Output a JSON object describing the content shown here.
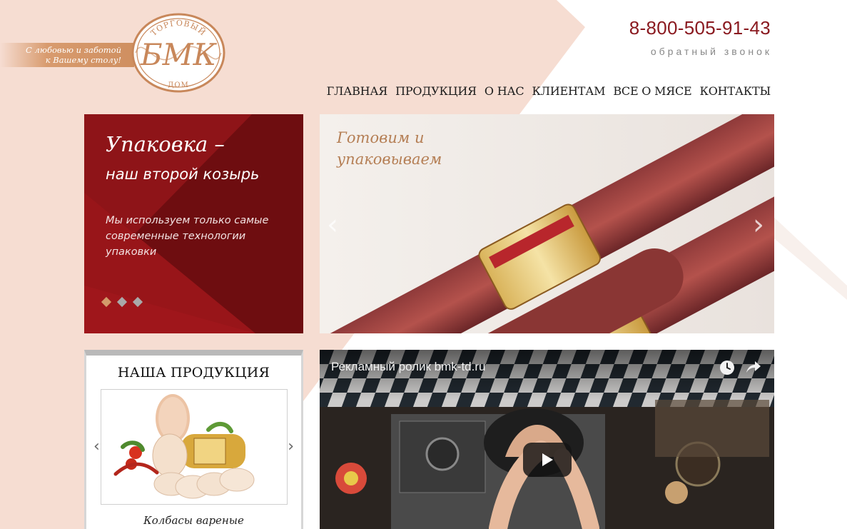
{
  "header": {
    "tagline_line1": "С любовью и заботой",
    "tagline_line2": "к Вашему столу!",
    "logo": {
      "top_text": "ТОРГОВЫЙ",
      "main_text": "БМК",
      "bottom_text": "ДОМ"
    },
    "phone": "8-800-505-91-43",
    "callback": "обратный звонок"
  },
  "nav": {
    "items": [
      "ГЛАВНАЯ",
      "ПРОДУКЦИЯ",
      "О НАС",
      "КЛИЕНТАМ",
      "ВСЕ О МЯСЕ",
      "КОНТАКТЫ"
    ]
  },
  "promo": {
    "title": "Упаковка –",
    "subtitle": "наш второй козырь",
    "body": "Мы используем только самые современные технологии упаковки",
    "slides": 3,
    "active_slide": 1
  },
  "slider": {
    "caption_line1": "Готовим и",
    "caption_line2": "упаковываем",
    "prev_icon": "chevron-left-icon",
    "next_icon": "chevron-right-icon"
  },
  "products": {
    "title": "НАША ПРОДУКЦИЯ",
    "caption": "Колбасы вареные"
  },
  "video": {
    "title": "Рекламный ролик bmk-td.ru",
    "icons": [
      "clock-icon",
      "share-icon",
      "play-icon"
    ]
  },
  "colors": {
    "accent": "#8a1a20",
    "promo_red": "#7b1013",
    "peach": "#f6ddd2",
    "copper": "#c8875a"
  }
}
